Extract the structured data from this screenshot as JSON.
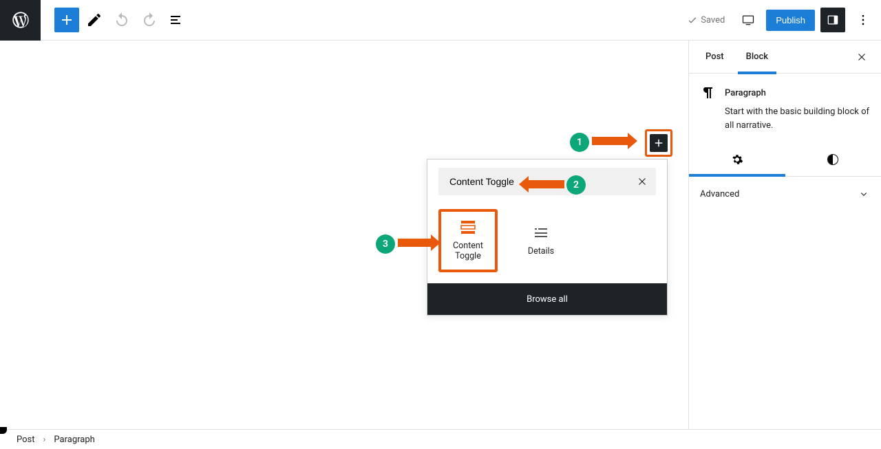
{
  "toolbar": {
    "saved_label": "Saved",
    "publish_label": "Publish"
  },
  "sidebar": {
    "tabs": {
      "post": "Post",
      "block": "Block"
    },
    "block": {
      "title": "Paragraph",
      "description": "Start with the basic building block of all narrative."
    },
    "advanced_label": "Advanced"
  },
  "inserter": {
    "search_value": "Content Toggle",
    "results": [
      {
        "label": "Content Toggle"
      },
      {
        "label": "Details"
      }
    ],
    "browse_all_label": "Browse all"
  },
  "breadcrumb": {
    "root": "Post",
    "current": "Paragraph"
  },
  "annotations": {
    "n1": "1",
    "n2": "2",
    "n3": "3"
  }
}
